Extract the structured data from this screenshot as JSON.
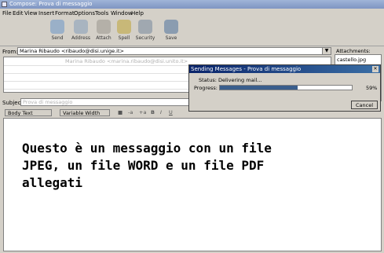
{
  "window": {
    "title": "Compose: Prova di messaggio"
  },
  "menu": [
    "File",
    "Edit",
    "View",
    "Insert",
    "Format",
    "Options",
    "Tools",
    "Window",
    "Help"
  ],
  "toolbar": [
    {
      "label": "Send",
      "icon": "send-icon"
    },
    {
      "label": "Address",
      "icon": "address-book-icon"
    },
    {
      "label": "Attach",
      "icon": "paperclip-icon"
    },
    {
      "label": "Spell",
      "icon": "spell-check-icon"
    },
    {
      "label": "Security",
      "icon": "lock-icon"
    },
    {
      "label": "Save",
      "icon": "save-icon"
    }
  ],
  "header": {
    "from_label": "From:",
    "from_value": "Marina Ribaudo <ribaudo@disi.unige.it>",
    "to_field": "Marina Ribaudo <marina.ribaudo@disi.unito.it>",
    "subject_label": "Subject:",
    "subject_value": "Prova di messaggio"
  },
  "attachments": {
    "label": "Attachments:",
    "items": [
      "castello.jpg"
    ]
  },
  "format": {
    "style": "Body Text",
    "font": "Variable Width"
  },
  "body": "Questo è un messaggio con un file\nJPEG, un file WORD e un file PDF\nallegati",
  "dialog": {
    "title": "Sending Messages - Prova di messaggio",
    "status_label": "Status:",
    "status_value": "Delivering mail...",
    "progress_label": "Progress:",
    "progress_value": 59,
    "progress_text": "59%",
    "cancel": "Cancel"
  },
  "colors": {
    "titlebar": "#0a246a",
    "progress": "#3a5e8c"
  }
}
